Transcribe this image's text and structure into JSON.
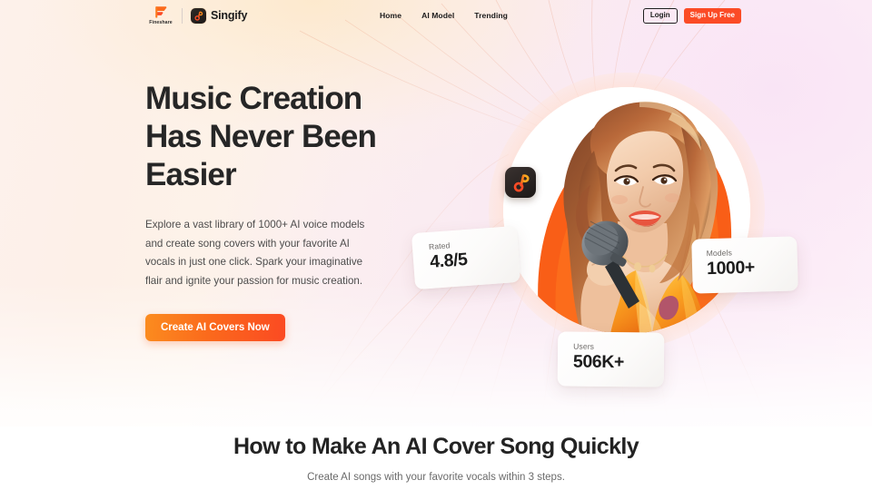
{
  "header": {
    "fineshare_brand": "Fineshare",
    "product_brand": "Singify",
    "nav": [
      {
        "label": "Home"
      },
      {
        "label": "AI Model"
      },
      {
        "label": "Trending"
      }
    ],
    "login_label": "Login",
    "signup_label": "Sign Up Free"
  },
  "hero": {
    "title_line1": "Music Creation",
    "title_line2": "Has Never Been",
    "title_line3": "Easier",
    "paragraph": "Explore a vast library of 1000+ AI voice models and create song covers with your favorite AI vocals in just one click. Spark your imaginative flair and ignite your passion for music creation.",
    "cta_label": "Create AI Covers Now"
  },
  "stats": [
    {
      "label": "Rated",
      "value": "4.8/5"
    },
    {
      "label": "Models",
      "value": "1000+"
    },
    {
      "label": "Users",
      "value": "506K+"
    }
  ],
  "section": {
    "title": "How to Make An AI Cover Song Quickly",
    "subtitle": "Create AI songs with your favorite vocals within 3 steps."
  },
  "colors": {
    "accent_red": "#fb4b26",
    "accent_orange": "#fb8c1f",
    "ink": "#262626",
    "bg_cream": "#fdf1ec",
    "bg_pink": "#f9e8f4"
  }
}
